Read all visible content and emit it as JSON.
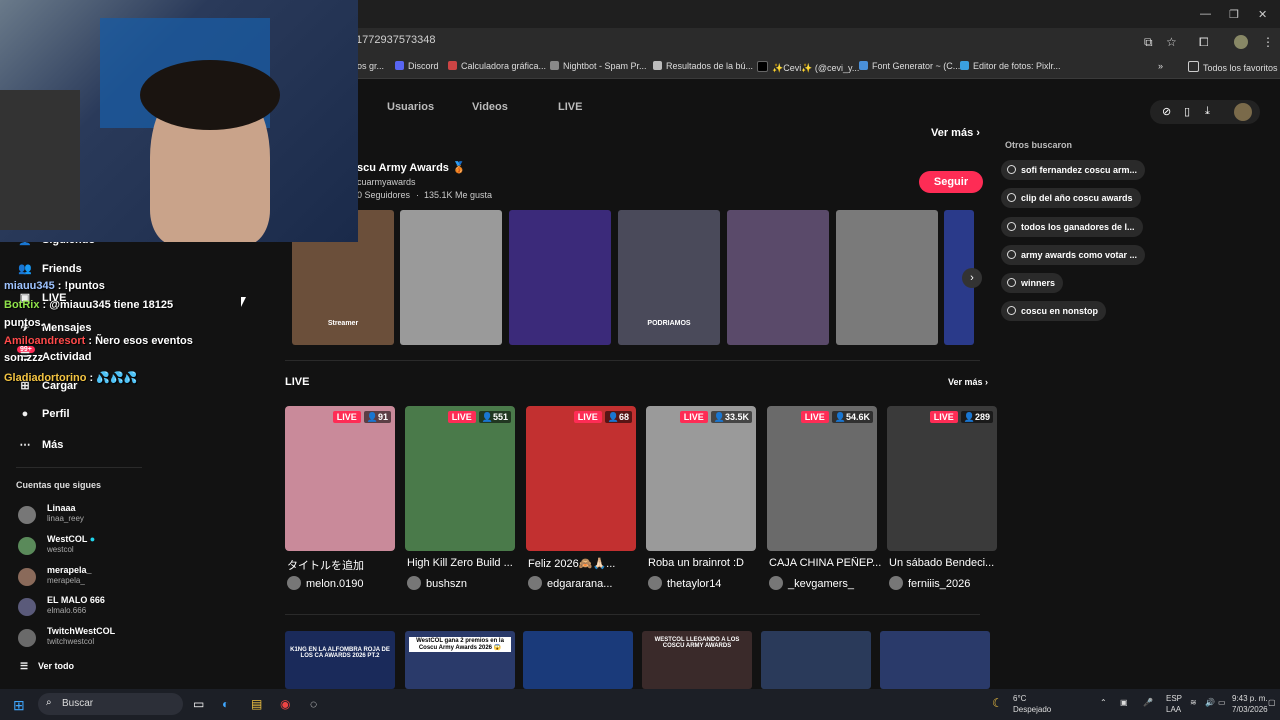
{
  "browser": {
    "url_fragment": "1772937573348",
    "bookmarks": [
      "os gr...",
      "Discord",
      "Calculadora gráfica...",
      "Nightbot - Spam Pr...",
      "Resultados de la bú...",
      "✨Cevi✨ (@cevi_y...",
      "Font Generator ~ (C...",
      "Editor de fotos: Pixlr..."
    ],
    "bookmarks_folder": "Todos los favoritos"
  },
  "tabs": [
    "Usuarios",
    "Videos",
    "LIVE"
  ],
  "account": {
    "name": "scu Army Awards 🥉",
    "handle": "cuarmyawards",
    "followers": "0 Seguidores",
    "sep": "·",
    "likes": "135.1K Me gusta",
    "follow_button": "Seguir",
    "see_more": "Ver más"
  },
  "videos": [
    {
      "caption": "Streamer",
      "color": "#6b4f3a"
    },
    {
      "caption": "",
      "color": "#9a9a9a"
    },
    {
      "caption": "",
      "color": "#3b2a7a"
    },
    {
      "caption": "PODRIAMOS",
      "color": "#4a4a5a"
    },
    {
      "caption": "",
      "color": "#5a4a6a"
    },
    {
      "caption": "",
      "color": "#7a7a7a"
    }
  ],
  "live_section": {
    "title": "LIVE",
    "see_more": "Ver más",
    "label": "LIVE",
    "cards": [
      {
        "viewers": "91",
        "title": "タイトルを追加",
        "user": "melon.0190",
        "color": "#c98a9a"
      },
      {
        "viewers": "551",
        "title": "High Kill Zero Build ...",
        "user": "bushszn",
        "color": "#4a7a4a"
      },
      {
        "viewers": "68",
        "title": "Feliz 2026🙈🙏🏻...",
        "user": "edgararana...",
        "color": "#c23030"
      },
      {
        "viewers": "33.5K",
        "title": "Roba un brainrot :D",
        "user": "thetaylor14",
        "color": "#9a9a9a"
      },
      {
        "viewers": "54.6K",
        "title": "CAJA CHINA PEÑEP...",
        "user": "_kevgamers_",
        "color": "#6a6a6a"
      },
      {
        "viewers": "289",
        "title": "Un sábado Bendeci...",
        "user": "ferniiis_2026",
        "color": "#3a3a3a"
      }
    ]
  },
  "bottom_thumbs": [
    {
      "caption": "K1NG EN LA ALFOMBRA ROJA DE LOS CA AWARDS 2026 PT.2",
      "color": "#1a2a5a"
    },
    {
      "caption": "WestCOL gana 2 premios en la Coscu Army Awards 2026 😱",
      "color": "#2a3a6a"
    },
    {
      "caption": "",
      "color": "#1a3a7a"
    },
    {
      "caption": "WESTCOL LLEGANDO A LOS COSCU ARMY AWARDS",
      "color": "#3a2a2a"
    },
    {
      "caption": "",
      "color": "#2a3a5a"
    },
    {
      "caption": "",
      "color": "#2a3a6a"
    }
  ],
  "sidebar": {
    "items": [
      {
        "label": "Siguiendo",
        "icon": "following"
      },
      {
        "label": "Friends",
        "icon": "friends"
      },
      {
        "label": "LIVE",
        "icon": "live"
      },
      {
        "label": "Mensajes",
        "icon": "messages",
        "badge": "99+"
      },
      {
        "label": "Actividad",
        "icon": "activity"
      },
      {
        "label": "Cargar",
        "icon": "upload"
      },
      {
        "label": "Perfil",
        "icon": "profile"
      },
      {
        "label": "Más",
        "icon": "more"
      }
    ],
    "following_title": "Cuentas que sigues",
    "following": [
      {
        "name": "Linaaa",
        "handle": "linaa_reey"
      },
      {
        "name": "WestCOL",
        "handle": "westcol"
      },
      {
        "name": "merapela_",
        "handle": "merapela_"
      },
      {
        "name": "EL MALO 666",
        "handle": "elmalo.666"
      },
      {
        "name": "TwitchWestCOL",
        "handle": "twitchwestcol"
      }
    ],
    "see_all": "Ver todo"
  },
  "chat": [
    {
      "user": "miauu345",
      "msg": " : !puntos",
      "color": "#9ec3ff"
    },
    {
      "user": "BotRix",
      "msg": " : @miauu345 tiene 18125",
      "color": "#8fe34a"
    },
    {
      "user": "",
      "msg": "puntos.",
      "color": "#ffffff"
    },
    {
      "user": "Amiloandresort",
      "msg": " : Ñero esos eventos",
      "color": "#ff4a4a"
    },
    {
      "user": "",
      "msg": "son.zzz",
      "color": "#ffffff"
    },
    {
      "user": "Gladiadortorino",
      "msg": " : 💦💦💦",
      "color": "#f5c542"
    }
  ],
  "suggestions": {
    "title": "Otros buscaron",
    "items": [
      "sofi fernandez coscu arm...",
      "clip del año coscu awards",
      "todos los ganadores de l...",
      "army awards como votar ...",
      "winners",
      "coscu en nonstop"
    ]
  },
  "taskbar": {
    "search": "Buscar",
    "weather_temp": "6°C",
    "weather_text": "Despejado",
    "lang": "ESP",
    "lang2": "LAA",
    "time": "9:43 p. m.",
    "date": "7/03/2026"
  },
  "colors": {
    "accent": "#fe2c55",
    "bg": "#121212"
  }
}
